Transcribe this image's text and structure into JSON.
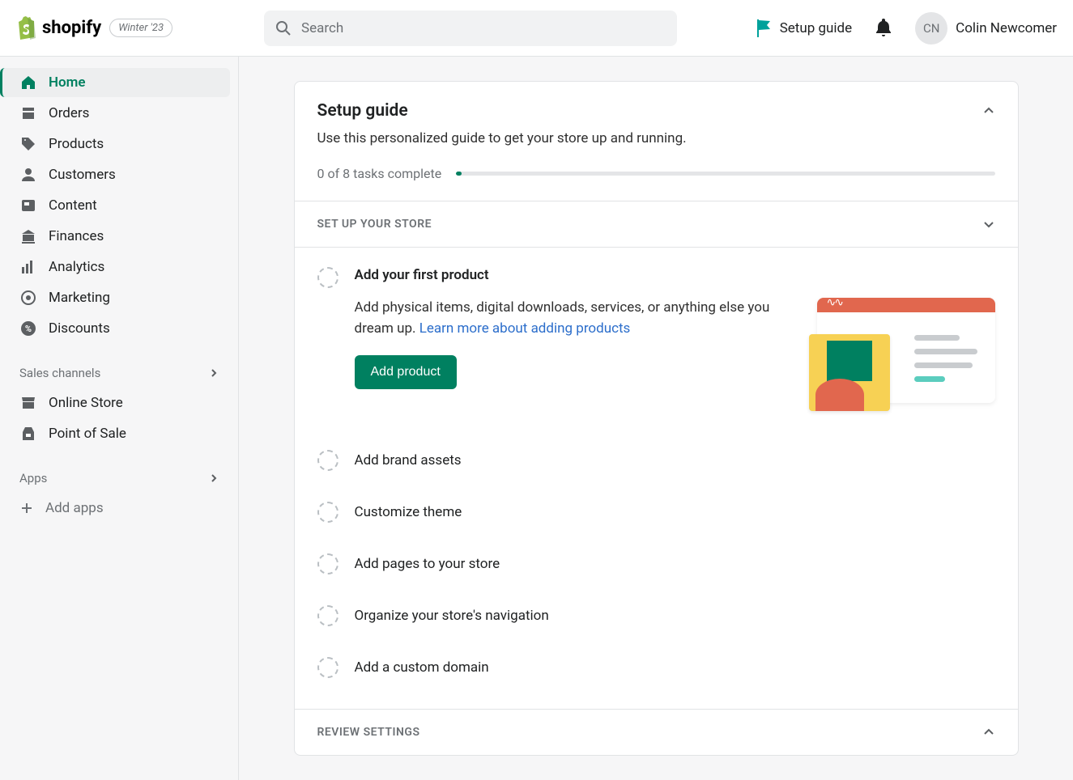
{
  "header": {
    "brand": "shopify",
    "badge": "Winter '23",
    "search_placeholder": "Search",
    "setup_guide_label": "Setup guide",
    "user_initials": "CN",
    "user_name": "Colin Newcomer"
  },
  "sidebar": {
    "items": [
      {
        "label": "Home",
        "icon": "home"
      },
      {
        "label": "Orders",
        "icon": "orders"
      },
      {
        "label": "Products",
        "icon": "products"
      },
      {
        "label": "Customers",
        "icon": "customers"
      },
      {
        "label": "Content",
        "icon": "content"
      },
      {
        "label": "Finances",
        "icon": "finances"
      },
      {
        "label": "Analytics",
        "icon": "analytics"
      },
      {
        "label": "Marketing",
        "icon": "marketing"
      },
      {
        "label": "Discounts",
        "icon": "discounts"
      }
    ],
    "sales_channels_label": "Sales channels",
    "channels": [
      {
        "label": "Online Store"
      },
      {
        "label": "Point of Sale"
      }
    ],
    "apps_label": "Apps",
    "add_apps_label": "Add apps"
  },
  "setup": {
    "title": "Setup guide",
    "description": "Use this personalized guide to get your store up and running.",
    "progress_text": "0 of 8 tasks complete",
    "section1_title": "SET UP YOUR STORE",
    "section2_title": "REVIEW SETTINGS",
    "active_task": {
      "title": "Add your first product",
      "description": "Add physical items, digital downloads, services, or anything else you dream up. ",
      "link_text": "Learn more about adding products",
      "button_label": "Add product"
    },
    "tasks": [
      {
        "label": "Add brand assets"
      },
      {
        "label": "Customize theme"
      },
      {
        "label": "Add pages to your store"
      },
      {
        "label": "Organize your store's navigation"
      },
      {
        "label": "Add a custom domain"
      }
    ]
  }
}
